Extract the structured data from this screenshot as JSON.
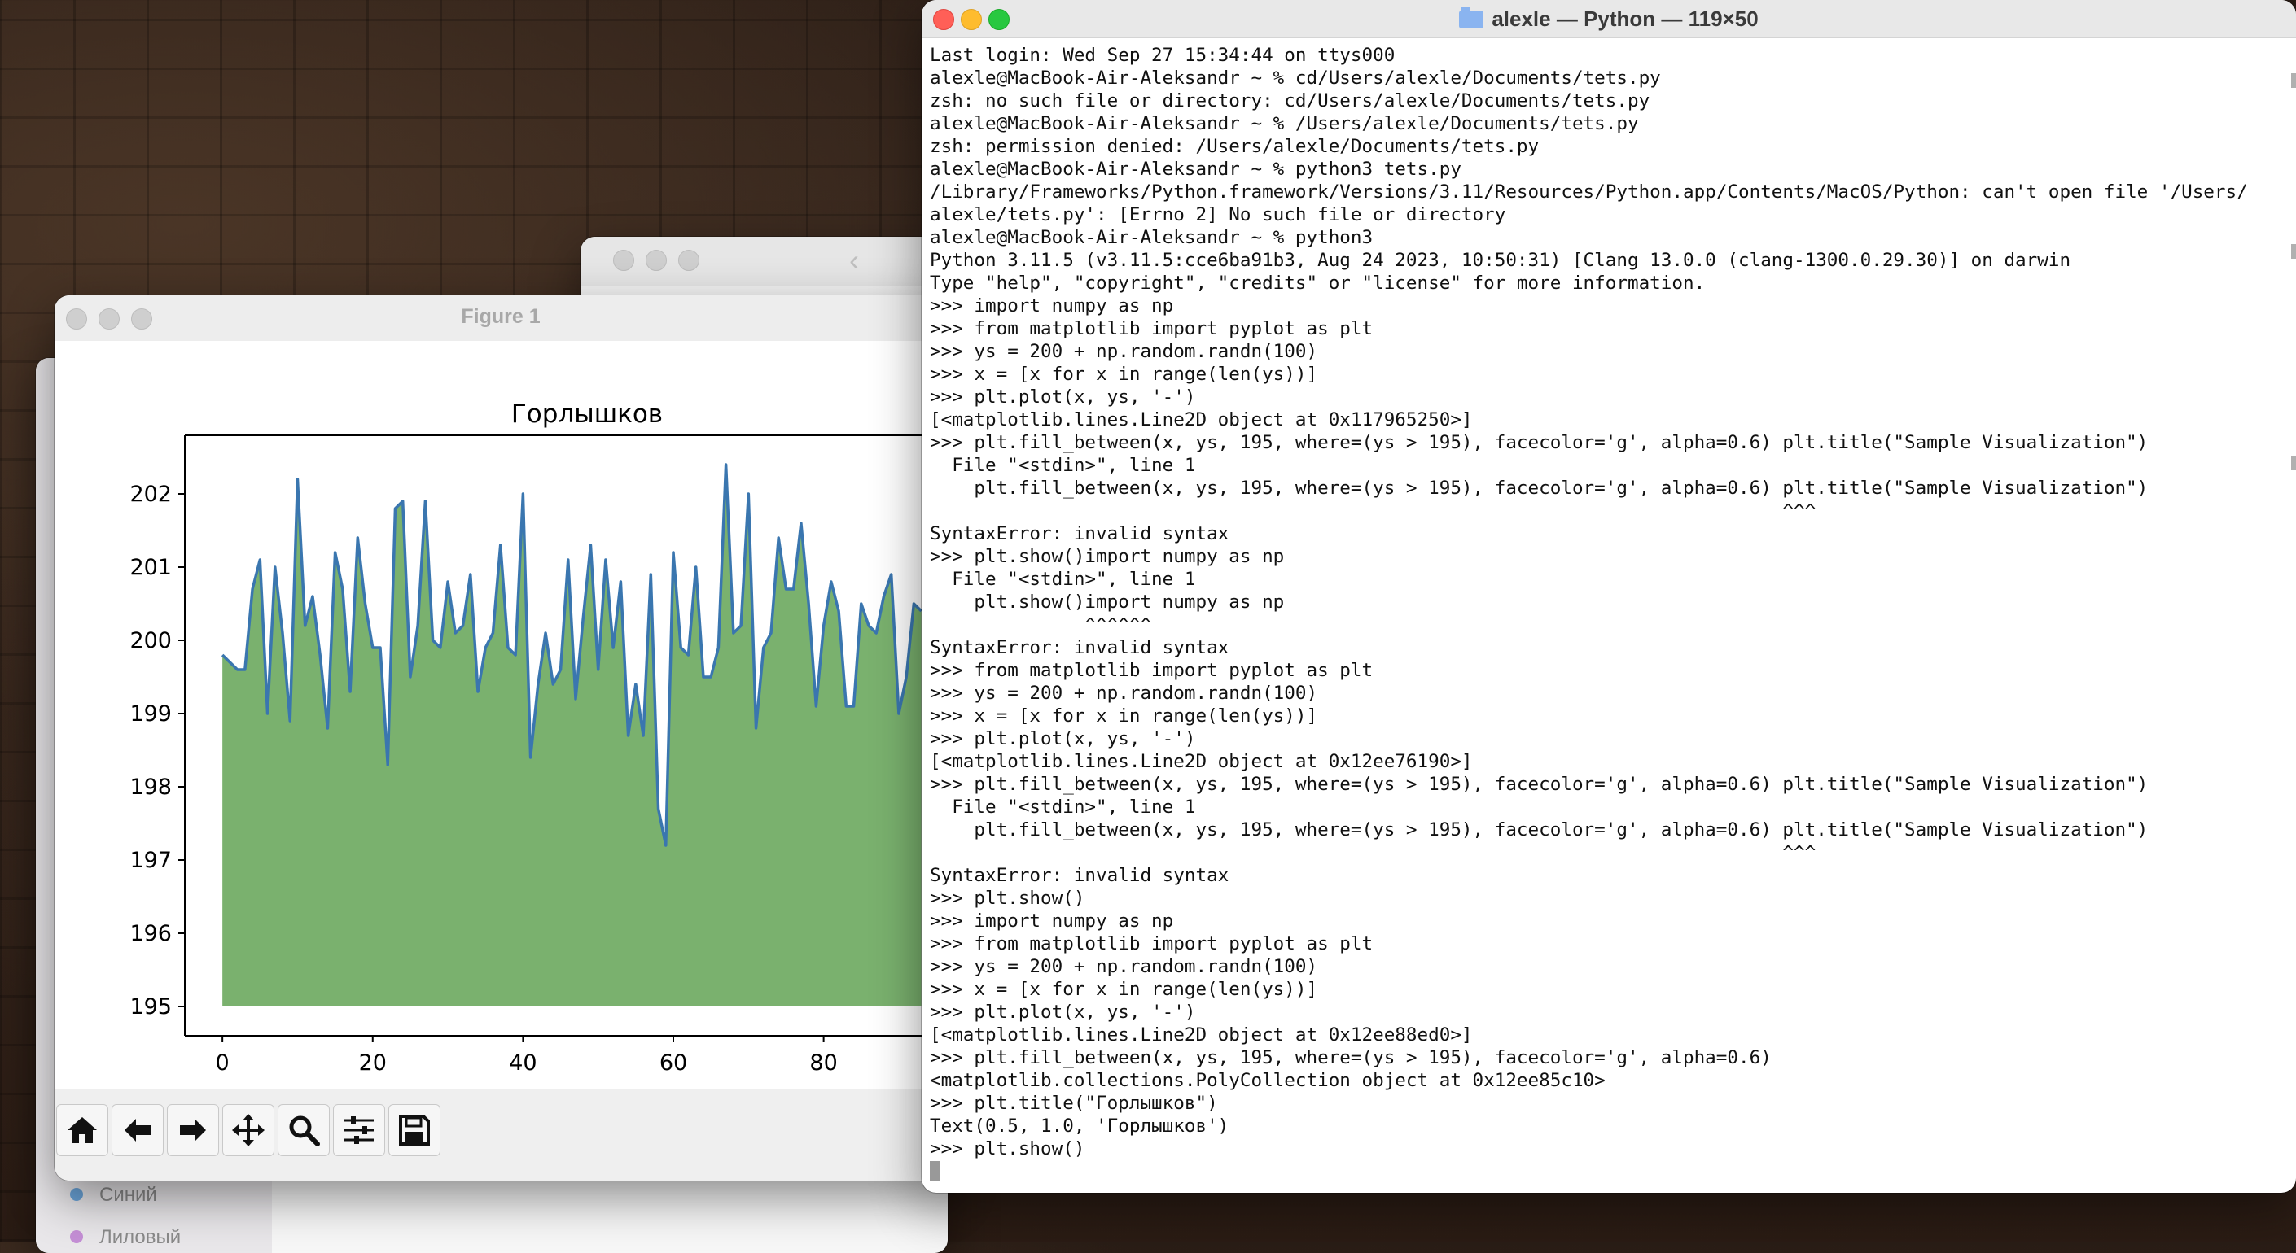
{
  "terminal": {
    "title": "alexle — Python — 119×50",
    "lines": [
      "Last login: Wed Sep 27 15:34:44 on ttys000",
      "alexle@MacBook-Air-Aleksandr ~ % cd/Users/alexle/Documents/tets.py",
      "zsh: no such file or directory: cd/Users/alexle/Documents/tets.py",
      "alexle@MacBook-Air-Aleksandr ~ % /Users/alexle/Documents/tets.py",
      "zsh: permission denied: /Users/alexle/Documents/tets.py",
      "alexle@MacBook-Air-Aleksandr ~ % python3 tets.py",
      "/Library/Frameworks/Python.framework/Versions/3.11/Resources/Python.app/Contents/MacOS/Python: can't open file '/Users/",
      "alexle/tets.py': [Errno 2] No such file or directory",
      "alexle@MacBook-Air-Aleksandr ~ % python3",
      "Python 3.11.5 (v3.11.5:cce6ba91b3, Aug 24 2023, 10:50:31) [Clang 13.0.0 (clang-1300.0.29.30)] on darwin",
      "Type \"help\", \"copyright\", \"credits\" or \"license\" for more information.",
      ">>> import numpy as np",
      ">>> from matplotlib import pyplot as plt",
      ">>> ys = 200 + np.random.randn(100)",
      ">>> x = [x for x in range(len(ys))]",
      ">>> plt.plot(x, ys, '-')",
      "[<matplotlib.lines.Line2D object at 0x117965250>]",
      ">>> plt.fill_between(x, ys, 195, where=(ys > 195), facecolor='g', alpha=0.6) plt.title(\"Sample Visualization\")",
      "  File \"<stdin>\", line 1",
      "    plt.fill_between(x, ys, 195, where=(ys > 195), facecolor='g', alpha=0.6) plt.title(\"Sample Visualization\")",
      "                                                                             ^^^",
      "SyntaxError: invalid syntax",
      ">>> plt.show()import numpy as np",
      "  File \"<stdin>\", line 1",
      "    plt.show()import numpy as np",
      "              ^^^^^^",
      "SyntaxError: invalid syntax",
      ">>> from matplotlib import pyplot as plt",
      ">>> ys = 200 + np.random.randn(100)",
      ">>> x = [x for x in range(len(ys))]",
      ">>> plt.plot(x, ys, '-')",
      "[<matplotlib.lines.Line2D object at 0x12ee76190>]",
      ">>> plt.fill_between(x, ys, 195, where=(ys > 195), facecolor='g', alpha=0.6) plt.title(\"Sample Visualization\")",
      "  File \"<stdin>\", line 1",
      "    plt.fill_between(x, ys, 195, where=(ys > 195), facecolor='g', alpha=0.6) plt.title(\"Sample Visualization\")",
      "                                                                             ^^^",
      "SyntaxError: invalid syntax",
      ">>> plt.show()",
      ">>> import numpy as np",
      ">>> from matplotlib import pyplot as plt",
      ">>> ys = 200 + np.random.randn(100)",
      ">>> x = [x for x in range(len(ys))]",
      ">>> plt.plot(x, ys, '-')",
      "[<matplotlib.lines.Line2D object at 0x12ee88ed0>]",
      ">>> plt.fill_between(x, ys, 195, where=(ys > 195), facecolor='g', alpha=0.6)",
      "<matplotlib.collections.PolyCollection object at 0x12ee85c10>",
      ">>> plt.title(\"Горлышков\")",
      "Text(0.5, 1.0, 'Горлышков')",
      ">>> plt.show()"
    ]
  },
  "figure_window": {
    "title": "Figure 1",
    "toolbar_icons": [
      "home-icon",
      "back-arrow-icon",
      "forward-arrow-icon",
      "pan-move-icon",
      "zoom-magnifier-icon",
      "configure-subplots-icon",
      "save-floppy-icon"
    ]
  },
  "app_sidebar": {
    "items": [
      "Синий",
      "Лиловый"
    ]
  },
  "colors": {
    "line": "#3a76af",
    "fill": "#7ab16e",
    "dot_blue": "#6ba4d9",
    "dot_purple": "#c58fd6"
  },
  "chart_data": {
    "type": "area",
    "title": "Горлышков",
    "xlabel": "",
    "ylabel": "",
    "baseline": 195,
    "xlim": [
      -5,
      99
    ],
    "ylim": [
      194.6,
      202.8
    ],
    "xticks": [
      0,
      20,
      40,
      60,
      80
    ],
    "yticks": [
      195,
      196,
      197,
      198,
      199,
      200,
      201,
      202
    ],
    "x": [
      0,
      1,
      2,
      3,
      4,
      5,
      6,
      7,
      8,
      9,
      10,
      11,
      12,
      13,
      14,
      15,
      16,
      17,
      18,
      19,
      20,
      21,
      22,
      23,
      24,
      25,
      26,
      27,
      28,
      29,
      30,
      31,
      32,
      33,
      34,
      35,
      36,
      37,
      38,
      39,
      40,
      41,
      42,
      43,
      44,
      45,
      46,
      47,
      48,
      49,
      50,
      51,
      52,
      53,
      54,
      55,
      56,
      57,
      58,
      59,
      60,
      61,
      62,
      63,
      64,
      65,
      66,
      67,
      68,
      69,
      70,
      71,
      72,
      73,
      74,
      75,
      76,
      77,
      78,
      79,
      80,
      81,
      82,
      83,
      84,
      85,
      86,
      87,
      88,
      89,
      90,
      91,
      92,
      93
    ],
    "values": [
      199.8,
      199.7,
      199.6,
      199.6,
      200.7,
      201.1,
      199.0,
      201.0,
      200.1,
      198.9,
      202.2,
      200.2,
      200.6,
      199.8,
      198.8,
      201.2,
      200.7,
      199.3,
      201.4,
      200.5,
      199.9,
      199.9,
      198.3,
      201.8,
      201.9,
      199.5,
      200.2,
      201.9,
      200.0,
      199.9,
      200.8,
      200.1,
      200.2,
      200.9,
      199.3,
      199.9,
      200.1,
      201.3,
      199.9,
      199.8,
      202.0,
      198.4,
      199.4,
      200.1,
      199.4,
      199.6,
      201.1,
      199.2,
      200.3,
      201.3,
      199.6,
      201.1,
      199.9,
      200.8,
      198.7,
      199.4,
      198.7,
      200.9,
      197.7,
      197.2,
      201.2,
      199.9,
      199.8,
      201.0,
      199.5,
      199.5,
      199.9,
      202.4,
      200.1,
      200.2,
      202.0,
      198.8,
      199.9,
      200.1,
      201.4,
      200.7,
      200.7,
      201.6,
      200.5,
      199.1,
      200.2,
      200.8,
      200.4,
      199.1,
      199.1,
      200.5,
      200.2,
      200.1,
      200.6,
      200.9,
      199.0,
      199.5,
      200.5,
      200.4
    ]
  }
}
